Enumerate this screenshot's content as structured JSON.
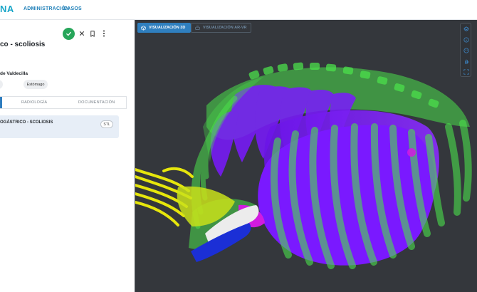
{
  "header": {
    "brand": "NA",
    "nav": [
      "ADMINISTRACIÓN",
      "CASOS"
    ]
  },
  "case": {
    "title": "co - scoliosis",
    "hospital": "de Valdecilla",
    "tags": [
      "",
      "Estómago"
    ]
  },
  "tabs": [
    "RADIOLOGÍA",
    "DOCUMENTACIÓN"
  ],
  "case_item": {
    "name": "OGÁSTRICO - SCOLIOSIS",
    "badge": "STL"
  },
  "viewer": {
    "tabs": [
      "VISUALIZACIÓN 3D",
      "VISUALIZACIÓN AR-VR"
    ],
    "tool_icons": [
      "layers-icon",
      "info-icon",
      "palette-icon",
      "hand-icon",
      "fullscreen-icon"
    ],
    "colors": {
      "bone": "#4be04b",
      "organ": "#7a19ff",
      "tendon": "#e6e60c",
      "vessel_blue": "#1b2fd6",
      "vessel_magenta": "#d21be0",
      "background": "#34373c"
    }
  },
  "colors": {
    "accent": "#2f7fbf",
    "confirm": "#27a65a",
    "brand": "#1aa6c8"
  }
}
